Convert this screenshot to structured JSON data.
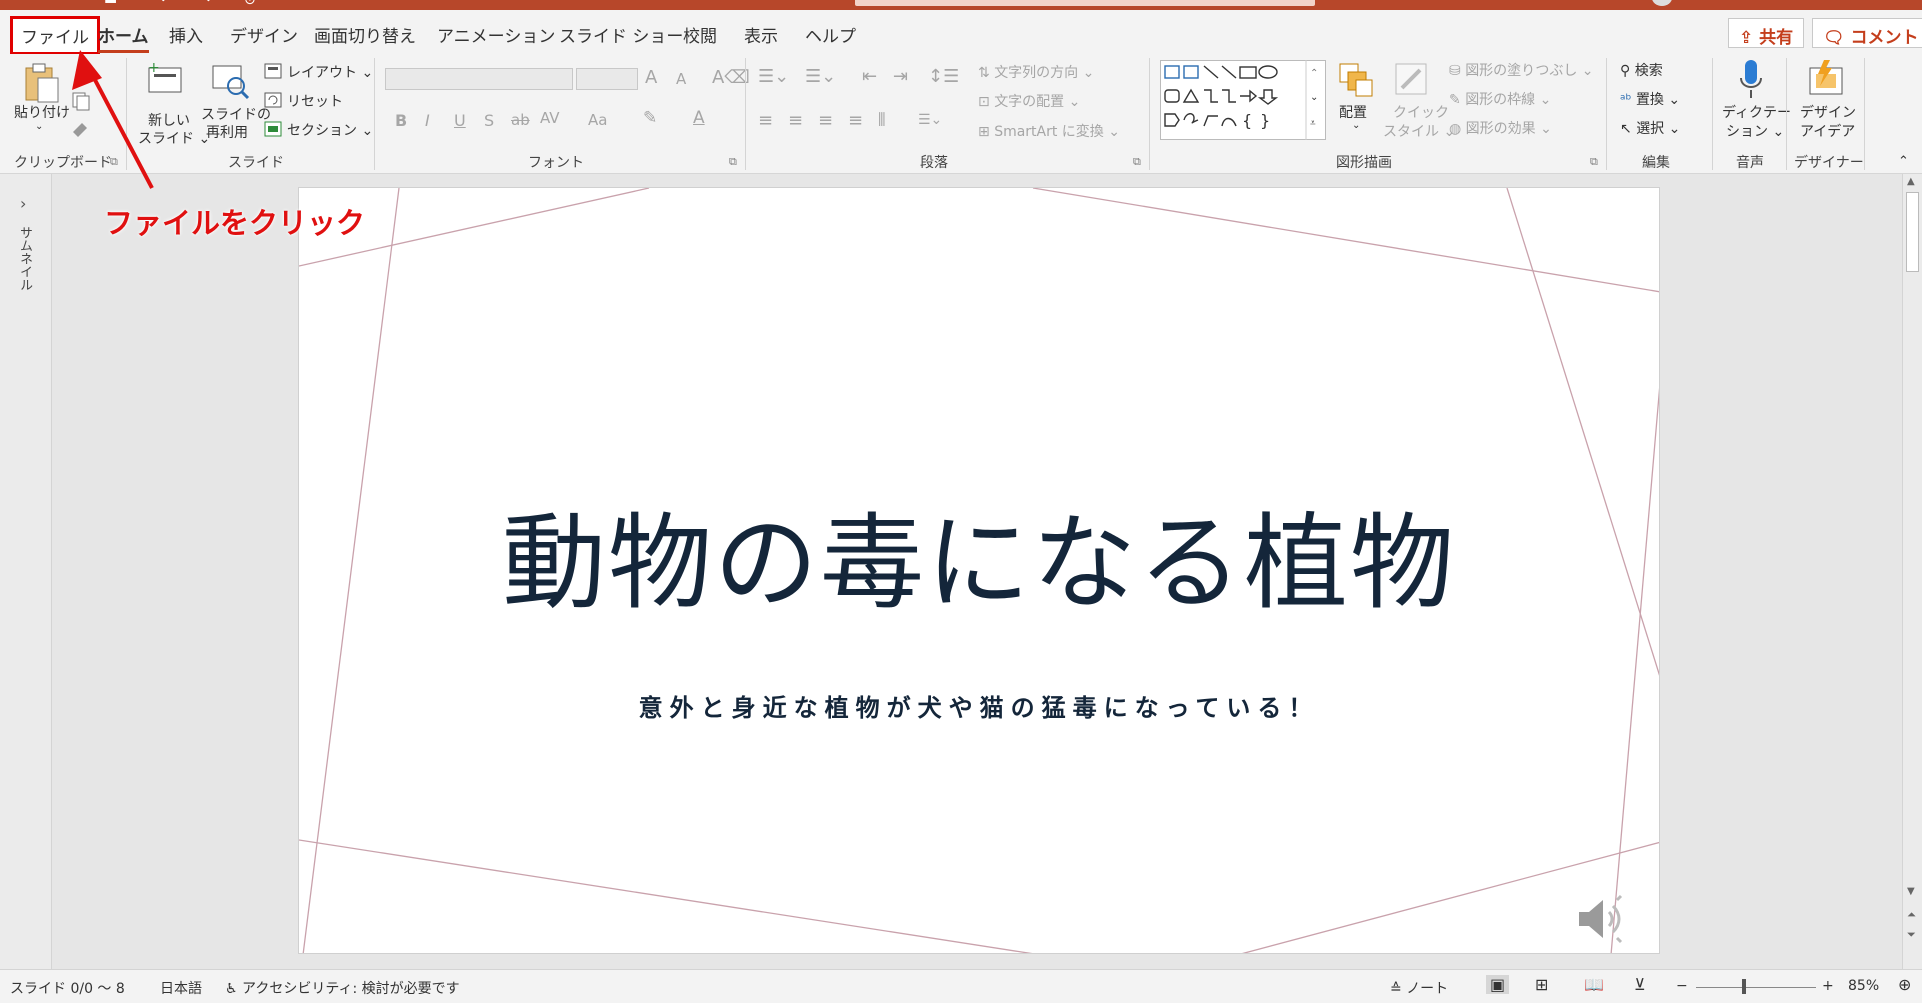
{
  "colors": {
    "accent": "#c43e1c",
    "titlebar": "#b7472a",
    "annotation": "#e01010",
    "slide_text": "#14263a",
    "slide_lines": "#c9a2ac"
  },
  "menu": {
    "file": "ファイル",
    "tabs": [
      "ホーム",
      "挿入",
      "デザイン",
      "画面切り替え",
      "アニメーション",
      "スライド ショー",
      "校閲",
      "表示",
      "ヘルプ"
    ],
    "share": "共有",
    "comment": "コメント"
  },
  "ribbon": {
    "clipboard": {
      "paste": "貼り付け",
      "label": "クリップボード"
    },
    "slides": {
      "new_slide_1": "新しい",
      "new_slide_2": "スライド ⌄",
      "reuse_1": "スライドの",
      "reuse_2": "再利用",
      "layout": "レイアウト ⌄",
      "reset": "リセット",
      "section": "セクション ⌄",
      "label": "スライド"
    },
    "font": {
      "label": "フォント",
      "bold": "B",
      "italic": "I",
      "underline": "U",
      "shadow": "S",
      "strike": "ab",
      "spacing": "AV",
      "case": "Aa",
      "grow": "A",
      "shrink": "A"
    },
    "paragraph": {
      "text_direction": "文字列の方向 ⌄",
      "align_text": "文字の配置 ⌄",
      "smartart": "SmartArt に変換 ⌄",
      "label": "段落"
    },
    "drawing": {
      "arrange": "配置",
      "quick_styles_1": "クイック",
      "quick_styles_2": "スタイル ⌄",
      "fill": "図形の塗りつぶし ⌄",
      "outline": "図形の枠線 ⌄",
      "effects": "図形の効果 ⌄",
      "label": "図形描画"
    },
    "editing": {
      "find": "検索",
      "replace": "置換",
      "select": "選択 ⌄",
      "label": "編集"
    },
    "voice": {
      "dictate_1": "ディクテー",
      "dictate_2": "ション ⌄",
      "label": "音声"
    },
    "designer": {
      "ideas_1": "デザイン",
      "ideas_2": "アイデア",
      "label": "デザイナー"
    }
  },
  "thumbnail_pane": {
    "label": "サムネイル"
  },
  "slide": {
    "title": "動物の毒になる植物",
    "subtitle": "意外と身近な植物が犬や猫の猛毒になっている！"
  },
  "annotation": {
    "text": "ファイルをクリック"
  },
  "status": {
    "slide": "スライド 0/0 ～ 8",
    "language": "日本語",
    "accessibility": "アクセシビリティ: 検討が必要です",
    "notes": "ノート",
    "zoom": "85%"
  }
}
